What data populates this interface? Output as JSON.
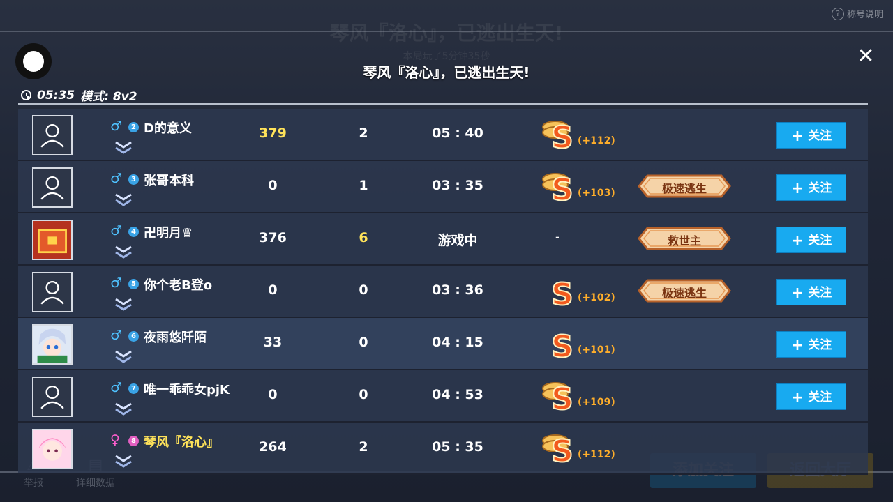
{
  "bg": {
    "title": "琴风『洛心』，已逃出生天!",
    "sub": "本局玩了5分钟35秒",
    "help_label": "称号说明",
    "add_follow_label": "添加关注",
    "back_lobby_label": "返回大厅",
    "report_label": "举报",
    "details_label": "详细数据"
  },
  "header": {
    "title": "琴风『洛心』，已逃出生天!",
    "time": "05:35",
    "mode": "模式: 8v2",
    "close_glyph": "✕"
  },
  "colors": {
    "accent": "#18aaf0",
    "gold": "#ffe35a",
    "bonus": "#ffae2a",
    "male": "#4fc2ff",
    "female": "#ff5fd0"
  },
  "players": [
    {
      "gender": "♂",
      "gender_type": "m",
      "rank": "2",
      "name": "D的意义",
      "name_gold": false,
      "avatar": "default",
      "score": "379",
      "score_yellow": true,
      "kills": "2",
      "kills_yellow": false,
      "time": "05 : 40",
      "grade": "S",
      "grade_stack": true,
      "bonus": "(+112)",
      "badge": "",
      "follow": "关注"
    },
    {
      "gender": "♂",
      "gender_type": "m",
      "rank": "3",
      "name": "张哥本科",
      "name_gold": false,
      "avatar": "default",
      "score": "0",
      "score_yellow": false,
      "kills": "1",
      "kills_yellow": false,
      "time": "03 : 35",
      "grade": "S",
      "grade_stack": true,
      "bonus": "(+103)",
      "badge": "极速逃生",
      "follow": "关注"
    },
    {
      "gender": "♂",
      "gender_type": "m",
      "rank": "4",
      "name": "卍明月♛",
      "name_gold": false,
      "avatar": "chest",
      "score": "376",
      "score_yellow": false,
      "kills": "6",
      "kills_yellow": true,
      "time": "游戏中",
      "grade": "-",
      "grade_stack": false,
      "bonus": "",
      "badge": "救世主",
      "follow": "关注"
    },
    {
      "gender": "♂",
      "gender_type": "m",
      "rank": "5",
      "name": "你个老B登o",
      "name_gold": false,
      "avatar": "default",
      "score": "0",
      "score_yellow": false,
      "kills": "0",
      "kills_yellow": false,
      "time": "03 : 36",
      "grade": "S",
      "grade_stack": false,
      "bonus": "(+102)",
      "badge": "极速逃生",
      "follow": "关注"
    },
    {
      "gender": "♂",
      "gender_type": "m",
      "rank": "6",
      "name": "夜雨悠阡陌",
      "name_gold": false,
      "avatar": "anime-blue",
      "score": "33",
      "score_yellow": false,
      "kills": "0",
      "kills_yellow": false,
      "time": "04 : 15",
      "grade": "S",
      "grade_stack": false,
      "bonus": "(+101)",
      "badge": "",
      "follow": "关注"
    },
    {
      "gender": "♂",
      "gender_type": "m",
      "rank": "7",
      "name": "唯一乖乖女pjK",
      "name_gold": false,
      "avatar": "default",
      "score": "0",
      "score_yellow": false,
      "kills": "0",
      "kills_yellow": false,
      "time": "04 : 53",
      "grade": "S",
      "grade_stack": true,
      "bonus": "(+109)",
      "badge": "",
      "follow": "关注"
    },
    {
      "gender": "♀",
      "gender_type": "f",
      "rank": "8",
      "name": "琴风『洛心』",
      "name_gold": true,
      "avatar": "anime-pink",
      "score": "264",
      "score_yellow": false,
      "kills": "2",
      "kills_yellow": false,
      "time": "05 : 35",
      "grade": "S",
      "grade_stack": true,
      "bonus": "(+112)",
      "badge": "",
      "follow": ""
    }
  ]
}
